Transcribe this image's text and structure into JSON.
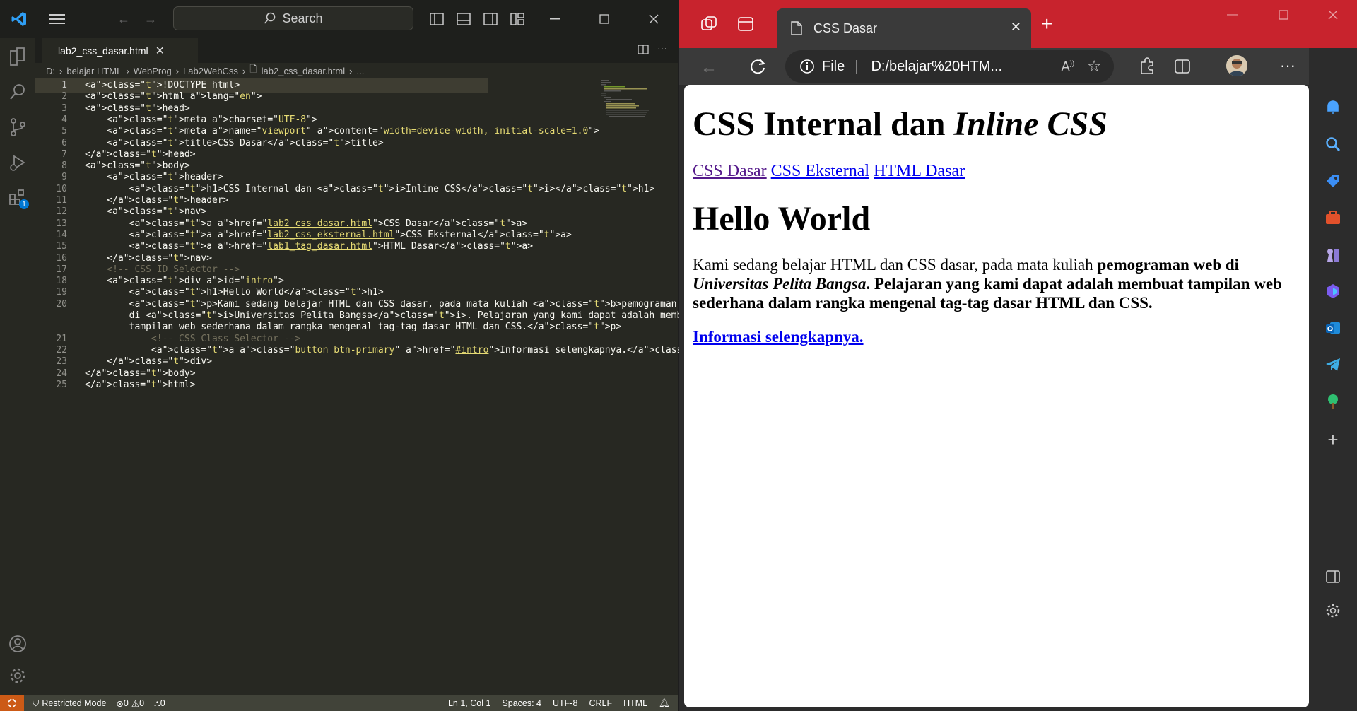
{
  "vscode": {
    "search_label": "Search",
    "tab_name": "lab2_css_dasar.html",
    "breadcrumb": [
      "D:",
      "belajar HTML",
      "WebProg",
      "Lab2WebCss",
      "lab2_css_dasar.html",
      "..."
    ],
    "extensions_badge": "1",
    "status": {
      "restricted": "Restricted Mode",
      "problems": "0",
      "warnings": "0",
      "ports": "0",
      "position": "Ln 1, Col 1",
      "spaces": "Spaces: 4",
      "encoding": "UTF-8",
      "eol": "CRLF",
      "language": "HTML"
    },
    "lines": [
      {
        "n": "1",
        "y": 0
      },
      {
        "n": "2"
      },
      {
        "n": "3"
      },
      {
        "n": "4"
      },
      {
        "n": "5"
      },
      {
        "n": "6"
      },
      {
        "n": "7"
      },
      {
        "n": "8"
      },
      {
        "n": "9"
      },
      {
        "n": "10"
      },
      {
        "n": "11"
      },
      {
        "n": "12"
      },
      {
        "n": "13"
      },
      {
        "n": "14"
      },
      {
        "n": "15"
      },
      {
        "n": "16"
      },
      {
        "n": "17"
      },
      {
        "n": "18"
      },
      {
        "n": "19"
      },
      {
        "n": "20"
      },
      {
        "n": "21"
      },
      {
        "n": "22"
      },
      {
        "n": "23"
      },
      {
        "n": "24"
      },
      {
        "n": "25"
      }
    ],
    "code": [
      "<!DOCTYPE html>",
      "<html lang=\"en\">",
      "<head>",
      "    <meta charset=\"UTF-8\">",
      "    <meta name=\"viewport\" content=\"width=device-width, initial-scale=1.0\">",
      "    <title>CSS Dasar</title>",
      "</head>",
      "<body>",
      "    <header>",
      "        <h1>CSS Internal dan <i>Inline CSS</i></h1>",
      "    </header>",
      "    <nav>",
      "        <a href=\"lab2_css_dasar.html\">CSS Dasar</a>",
      "        <a href=\"lab2_css_eksternal.html\">CSS Eksternal</a>",
      "        <a href=\"lab1_tag_dasar.html\">HTML Dasar</a>",
      "    </nav>",
      "    <!-- CSS ID Selector -->",
      "    <div id=\"intro\">",
      "        <h1>Hello World</h1>",
      "        <p>Kami sedang belajar HTML dan CSS dasar, pada mata kuliah <b>pemograman web<b>",
      "        di <i>Universitas Pelita Bangsa</i>. Pelajaran yang kami dapat adalah membuat",
      "        tampilan web sederhana dalam rangka mengenal tag-tag dasar HTML dan CSS.</p>",
      "            <!-- CSS Class Selector -->",
      "            <a class=\"button btn-primary\" href=\"#intro\">Informasi selengkapnya.</a>",
      "    </div>",
      "</body>",
      "</html>"
    ]
  },
  "edge": {
    "tab_title": "CSS Dasar",
    "file_label": "File",
    "url": "D:/belajar%20HTM...",
    "page": {
      "h1_plain": "CSS Internal dan ",
      "h1_italic": "Inline CSS",
      "nav": [
        "CSS Dasar",
        "CSS Eksternal",
        "HTML Dasar"
      ],
      "h2": "Hello World",
      "p_plain": "Kami sedang belajar HTML dan CSS dasar, pada mata kuliah ",
      "p_bold1": "pemograman web di ",
      "p_bold_italic": "Universitas Pelita Bangsa",
      "p_bold2": ". Pelajaran yang kami dapat adalah membuat tampilan web sederhana dalam rangka mengenal tag-tag dasar HTML dan CSS.",
      "link": "Informasi selengkapnya."
    }
  }
}
